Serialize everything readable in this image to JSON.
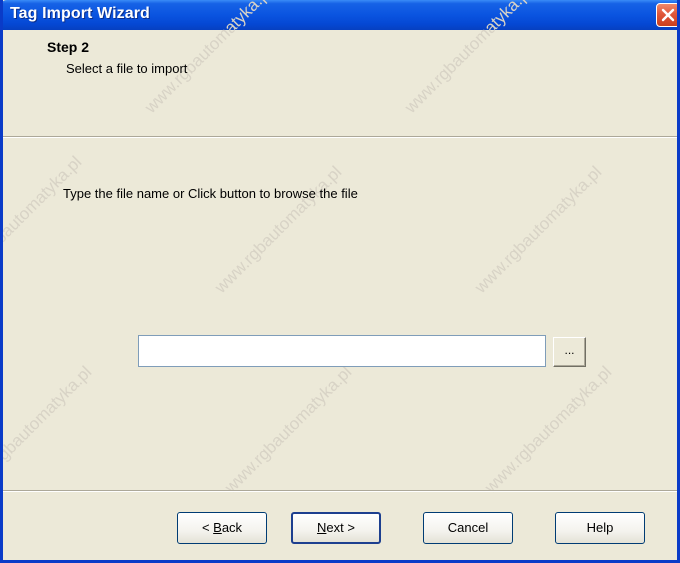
{
  "window": {
    "title": "Tag Import Wizard"
  },
  "header": {
    "step_title": "Step 2",
    "step_subtitle": "Select a file to import"
  },
  "content": {
    "instruction": "Type the file name or Click button to browse the file",
    "file_input_value": "",
    "file_input_placeholder": "",
    "browse_label": "..."
  },
  "buttons": {
    "back_label": "< Back",
    "back_mnemonic": "B",
    "next_label": "Next >",
    "next_mnemonic": "N",
    "cancel_label": "Cancel",
    "help_label": "Help"
  },
  "colors": {
    "titlebar": "#0a54e0",
    "close_button": "#e0573a",
    "dialog_bg": "#ece9d8"
  },
  "watermark_text": "www.rgbautomatyka.pl"
}
